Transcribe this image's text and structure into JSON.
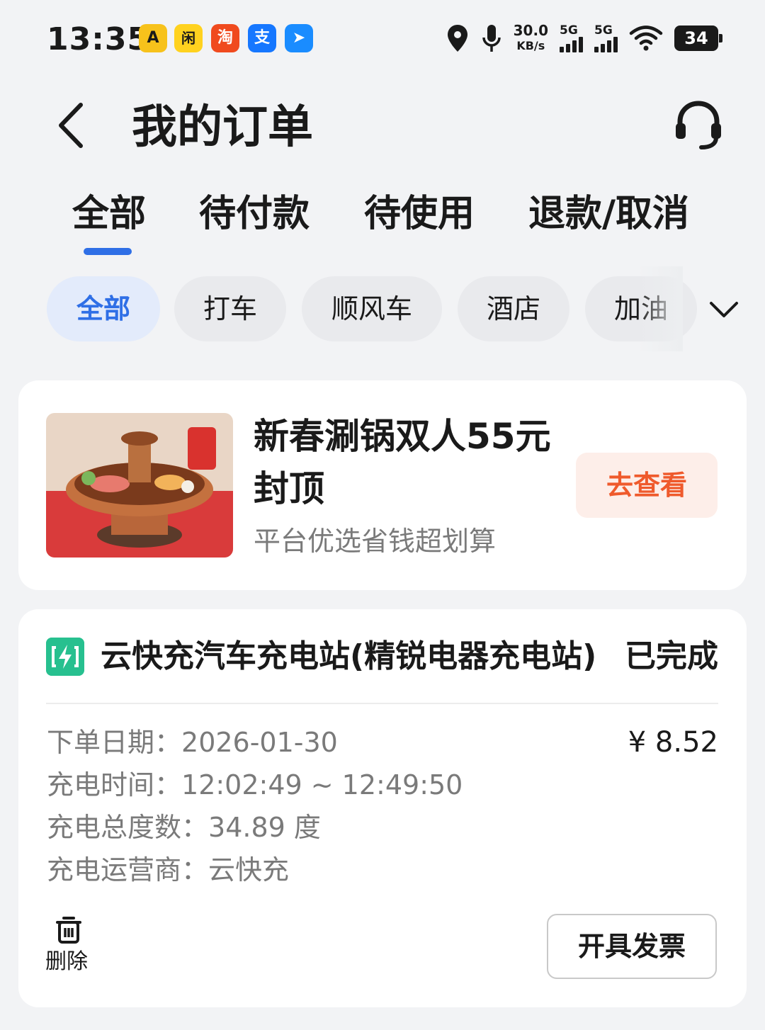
{
  "status_bar": {
    "time": "13:35",
    "apps": [
      {
        "icon": "yellow-car-app-icon",
        "glyph": "A",
        "color": "#f7c21b"
      },
      {
        "icon": "xianyu-app-icon",
        "glyph": "闲",
        "color": "#ffd21f"
      },
      {
        "icon": "taobao-app-icon",
        "glyph": "淘",
        "color": "#f04a1e"
      },
      {
        "icon": "alipay-app-icon",
        "glyph": "支",
        "color": "#1677ff"
      },
      {
        "icon": "dingtalk-app-icon",
        "glyph": "➤",
        "color": "#1a8cff"
      }
    ],
    "net_speed_value": "30.0",
    "net_speed_unit": "KB/s",
    "signal_1_label": "5G",
    "signal_2_label": "5G",
    "battery": "34"
  },
  "header": {
    "title": "我的订单"
  },
  "tabs": [
    "全部",
    "待付款",
    "待使用",
    "退款/取消"
  ],
  "filters": [
    "全部",
    "打车",
    "顺风车",
    "酒店",
    "加油"
  ],
  "promo": {
    "title": "新春涮锅双人55元封顶",
    "subtitle": "平台优选省钱超划算",
    "button": "去查看"
  },
  "order": {
    "station": "云快充汽车充电站(精锐电器充电站)",
    "status": "已完成",
    "price": "¥ 8.52",
    "details": [
      {
        "label": "下单日期：",
        "value": "2026-01-30"
      },
      {
        "label": "充电时间：",
        "value": "12:02:49 ~ 12:49:50"
      },
      {
        "label": "充电总度数：",
        "value": "34.89 度"
      },
      {
        "label": "充电运营商：",
        "value": "云快充"
      }
    ],
    "delete_label": "删除",
    "invoice_button": "开具发票"
  },
  "colors": {
    "accent": "#2f6fe6",
    "promo_button_text": "#ef5a2c",
    "station_logo": "#27c08f"
  }
}
